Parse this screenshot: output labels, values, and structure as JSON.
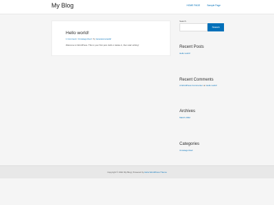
{
  "header": {
    "site_title": "My Blog",
    "nav": [
      "HOME PAGE",
      "Sample Page"
    ]
  },
  "post": {
    "title": "Hello world!",
    "meta": {
      "comments": "1 Comment",
      "category": "Uncategorized",
      "by": "By",
      "author": "lanacasmanaddr"
    },
    "excerpt": "Welcome to WordPress. This is your first post. Edit or delete it, then start writing!"
  },
  "sidebar": {
    "search": {
      "label": "Search",
      "button": "Search"
    },
    "recent_posts": {
      "title": "Recent Posts",
      "items": [
        "Hello world!"
      ]
    },
    "recent_comments": {
      "title": "Recent Comments",
      "author": "A WordPress Commenter",
      "on": "on",
      "post": "Hello world!"
    },
    "archives": {
      "title": "Archives",
      "items": [
        "March 2022"
      ]
    },
    "categories": {
      "title": "Categories",
      "items": [
        "Uncategorized"
      ]
    }
  },
  "footer": {
    "copyright": "Copyright © 2022 My Blog | Powered by",
    "theme_link": "Astra WordPress Theme"
  },
  "colors": {
    "accent": "#0170b9",
    "background": "#f5f5f5",
    "footer_bg": "#e8e8e8"
  }
}
